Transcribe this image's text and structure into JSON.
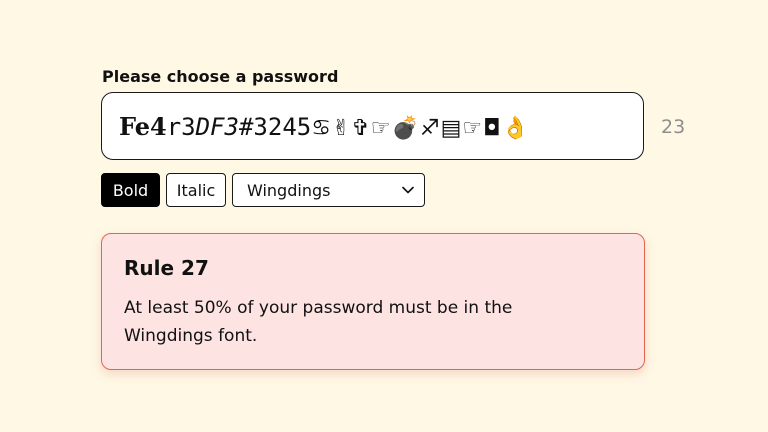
{
  "password_prompt": {
    "label": "Please choose a password"
  },
  "password": {
    "segments": {
      "bold": "Fe4",
      "plain": "r3",
      "italic": "DF3",
      "digits": "#3245",
      "wingdings": "♋✌✞☞💣♐▤☞◘👌"
    },
    "char_count": "23"
  },
  "toolbar": {
    "bold_label": "Bold",
    "italic_label": "Italic",
    "font_selected": "Wingdings"
  },
  "rule": {
    "title": "Rule 27",
    "body": "At least 50% of your password must be in the Wingdings font."
  },
  "colors": {
    "page_bg": "#fff8e5",
    "rule_bg": "#fde3e2",
    "rule_border": "#e0684f",
    "active_button_bg": "#000000",
    "count_text": "#8e8e8e"
  }
}
